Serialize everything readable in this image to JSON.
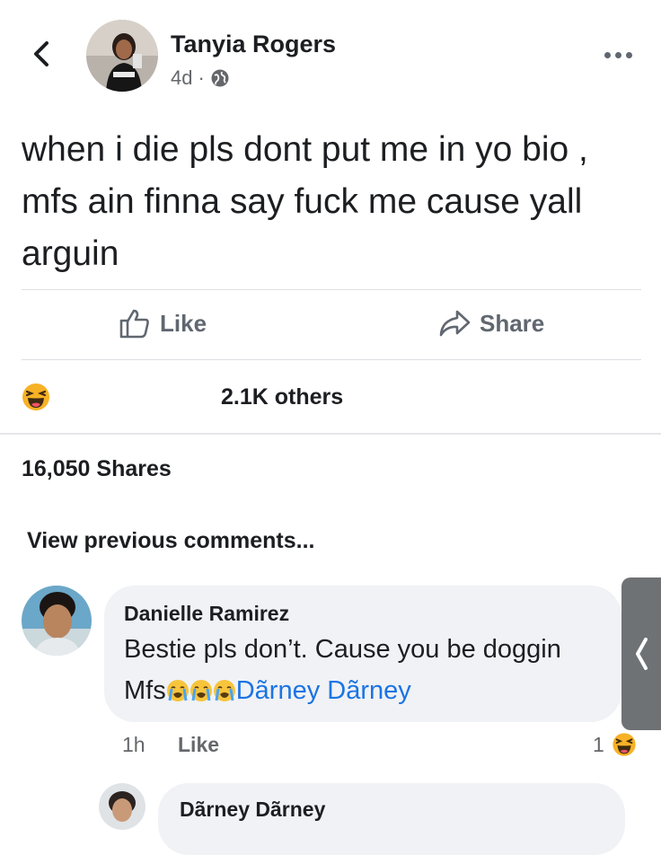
{
  "post": {
    "author": "Tanyia Rogers",
    "time": "4d",
    "separator": "·",
    "privacy_icon": "globe-icon",
    "text": "when i die pls dont put me in yo bio , mfs ain finna say fuck me cause yall arguin"
  },
  "actions": {
    "like_label": "Like",
    "share_label": "Share"
  },
  "reactions": {
    "icon": "haha-reaction-icon",
    "summary": "2.1K others"
  },
  "shares_text": "16,050 Shares",
  "view_previous": "View previous comments...",
  "comment": {
    "author": "Danielle Ramirez",
    "text_line1": "Bestie pls don’t. Cause you be doggin",
    "text_prefix": "Mfs",
    "emoji_icon": "crying-face-emoji",
    "mention": "Dãrney Dãrney",
    "time": "1h",
    "like_label": "Like",
    "reaction_count": "1"
  },
  "reply": {
    "author": "Dãrney Dãrney"
  },
  "colors": {
    "link": "#1b74e4",
    "muted": "#65676b",
    "bubble": "#f0f2f5",
    "haha": "#f7b125"
  }
}
